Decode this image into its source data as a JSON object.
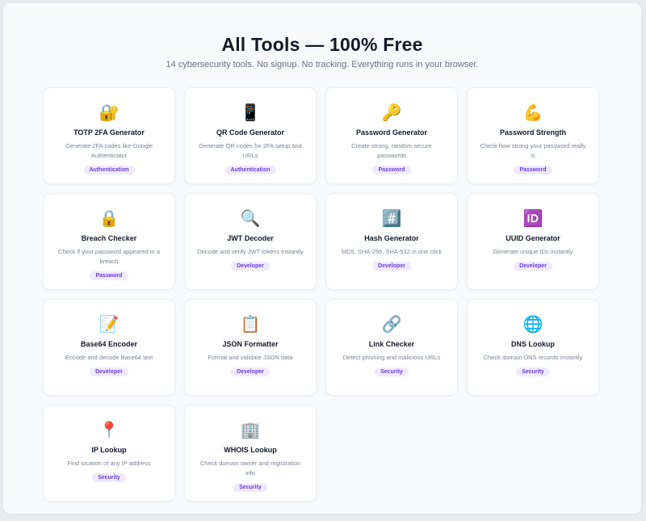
{
  "page": {
    "title": "All Tools — 100% Free",
    "subtitle": "14 cybersecurity tools. No signup. No tracking. Everything runs in your browser."
  },
  "colors": {
    "tag_bg": "#efeafd",
    "tag_text": "#6d3fe0",
    "title_text": "#141a27",
    "desc_text": "#7b8391"
  },
  "tools": [
    {
      "icon": "🔐",
      "icon_name": "lock-with-key-icon",
      "name": "TOTP 2FA Generator",
      "description": "Generate 2FA codes like Google Authenticator",
      "tag": "Authentication"
    },
    {
      "icon": "📱",
      "icon_name": "mobile-phone-icon",
      "name": "QR Code Generator",
      "description": "Generate QR codes for 2FA setup and URLs",
      "tag": "Authentication"
    },
    {
      "icon": "🔑",
      "icon_name": "key-icon",
      "name": "Password Generator",
      "description": "Create strong, random secure passwords",
      "tag": "Password"
    },
    {
      "icon": "💪",
      "icon_name": "flexed-biceps-icon",
      "name": "Password Strength",
      "description": "Check how strong your password really is",
      "tag": "Password"
    },
    {
      "icon": "🔒",
      "icon_name": "padlock-icon",
      "name": "Breach Checker",
      "description": "Check if your password appeared in a breach",
      "tag": "Password"
    },
    {
      "icon": "🔍",
      "icon_name": "magnifying-glass-icon",
      "name": "JWT Decoder",
      "description": "Decode and verify JWT tokens instantly",
      "tag": "Developer"
    },
    {
      "icon": "#️⃣",
      "icon_name": "hash-keycap-icon",
      "name": "Hash Generator",
      "description": "MD5, SHA-256, SHA-512 in one click",
      "tag": "Developer"
    },
    {
      "icon": "🆔",
      "icon_name": "id-button-icon",
      "name": "UUID Generator",
      "description": "Generate unique IDs instantly",
      "tag": "Developer"
    },
    {
      "icon": "📝",
      "icon_name": "memo-icon",
      "name": "Base64 Encoder",
      "description": "Encode and decode Base64 text",
      "tag": "Developer"
    },
    {
      "icon": "📋",
      "icon_name": "clipboard-icon",
      "name": "JSON Formatter",
      "description": "Format and validate JSON data",
      "tag": "Developer"
    },
    {
      "icon": "🔗",
      "icon_name": "link-icon",
      "name": "Link Checker",
      "description": "Detect phishing and malicious URLs",
      "tag": "Security"
    },
    {
      "icon": "🌐",
      "icon_name": "globe-icon",
      "name": "DNS Lookup",
      "description": "Check domain DNS records instantly",
      "tag": "Security"
    },
    {
      "icon": "📍",
      "icon_name": "map-pin-icon",
      "name": "IP Lookup",
      "description": "Find location of any IP address",
      "tag": "Security"
    },
    {
      "icon": "🏢",
      "icon_name": "office-building-icon",
      "name": "WHOIS Lookup",
      "description": "Check domain owner and registration info",
      "tag": "Security"
    }
  ]
}
